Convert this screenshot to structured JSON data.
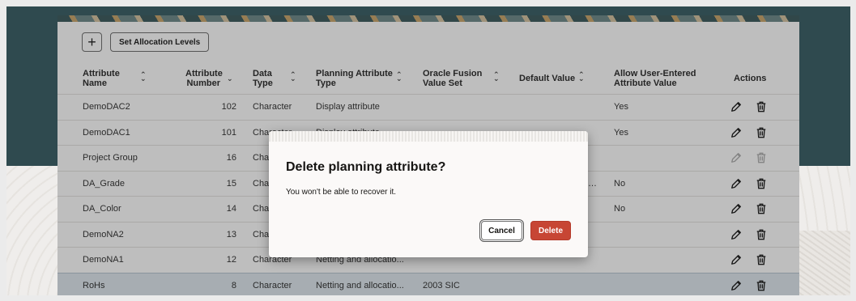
{
  "toolbar": {
    "add_label": "+",
    "set_levels_label": "Set Allocation Levels"
  },
  "columns": [
    {
      "line1": "Attribute",
      "line2": "Name"
    },
    {
      "line1": "Attribute",
      "line2": "Number"
    },
    {
      "line1": "Data",
      "line2": "Type"
    },
    {
      "line1": "Planning Attribute",
      "line2": "Type"
    },
    {
      "line1": "Oracle Fusion",
      "line2": "Value Set"
    },
    {
      "line1": "Default Value",
      "line2": ""
    },
    {
      "line1": "Allow User-Entered",
      "line2": "Attribute Value"
    },
    {
      "line1": "Actions",
      "line2": ""
    }
  ],
  "rows": [
    {
      "name": "DemoDAC2",
      "number": "102",
      "data_type": "Character",
      "planning_type": "Display attribute",
      "value_set": "",
      "default": "",
      "allow": "Yes",
      "disabled": false,
      "selected": false
    },
    {
      "name": "DemoDAC1",
      "number": "101",
      "data_type": "Character",
      "planning_type": "Display attribute",
      "value_set": "",
      "default": "",
      "allow": "Yes",
      "disabled": false,
      "selected": false
    },
    {
      "name": "Project Group",
      "number": "16",
      "data_type": "Cha",
      "planning_type": "",
      "value_set": "",
      "default": "",
      "allow": "",
      "disabled": true,
      "selected": false
    },
    {
      "name": "DA_Grade",
      "number": "15",
      "data_type": "Cha",
      "planning_type": "",
      "value_set": "",
      "default": "…",
      "allow": "No",
      "disabled": false,
      "selected": false
    },
    {
      "name": "DA_Color",
      "number": "14",
      "data_type": "Cha",
      "planning_type": "",
      "value_set": "",
      "default": "",
      "allow": "No",
      "disabled": false,
      "selected": false
    },
    {
      "name": "DemoNA2",
      "number": "13",
      "data_type": "Cha",
      "planning_type": "",
      "value_set": "",
      "default": "",
      "allow": "",
      "disabled": false,
      "selected": false
    },
    {
      "name": "DemoNA1",
      "number": "12",
      "data_type": "Character",
      "planning_type": "Netting and allocatio...",
      "value_set": "",
      "default": "",
      "allow": "",
      "disabled": false,
      "selected": false
    },
    {
      "name": "RoHs",
      "number": "8",
      "data_type": "Character",
      "planning_type": "Netting and allocatio...",
      "value_set": "2003 SIC",
      "default": "",
      "allow": "",
      "disabled": false,
      "selected": true
    }
  ],
  "dialog": {
    "title": "Delete planning attribute?",
    "message": "You won't be able to recover it.",
    "cancel_label": "Cancel",
    "delete_label": "Delete"
  },
  "colors": {
    "teal": "#2f4a4f",
    "delete": "#c74634",
    "selected_row": "#dfe8ef"
  },
  "icons": {
    "edit": "pencil-icon",
    "delete": "trash-icon",
    "sort": "sort-icon"
  }
}
